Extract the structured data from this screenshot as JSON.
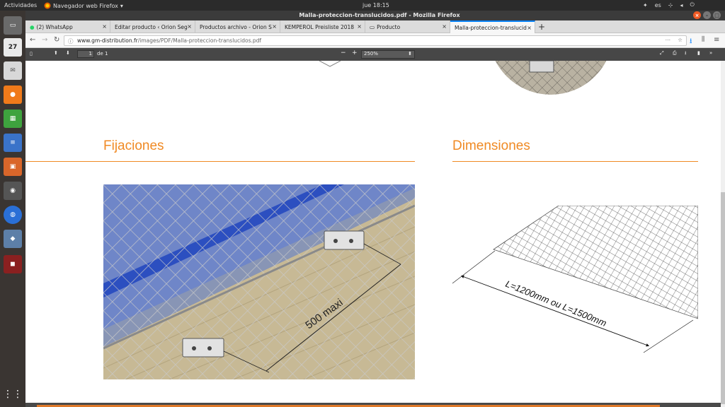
{
  "topbar": {
    "activities": "Actividades",
    "app": "Navegador web Firefox",
    "clock": "jue 18:15",
    "lang": "es"
  },
  "window": {
    "title": "Malla-proteccion-translucidos.pdf - Mozilla Firefox"
  },
  "tabs": [
    {
      "label": "(2) WhatsApp"
    },
    {
      "label": "Editar producto ‹ Orion Seg"
    },
    {
      "label": "Productos archivo - Orion S"
    },
    {
      "label": "KEMPEROL Preisliste 2018"
    },
    {
      "label": "Producto"
    },
    {
      "label": "Malla-proteccion-translucid"
    }
  ],
  "url": {
    "host": "www.gm-distribution.fr",
    "path": "/images/PDF/Malla-proteccion-translucidos.pdf"
  },
  "pdf": {
    "page": "1",
    "of": "de 1",
    "zoom": "250%"
  },
  "dock": {
    "calendar_day": "27"
  },
  "content": {
    "fijaciones": "Fijaciones",
    "dimensiones": "Dimensiones",
    "dim_label": "500 maxi",
    "length_label": "L=1200mm ou L=1500mm"
  }
}
